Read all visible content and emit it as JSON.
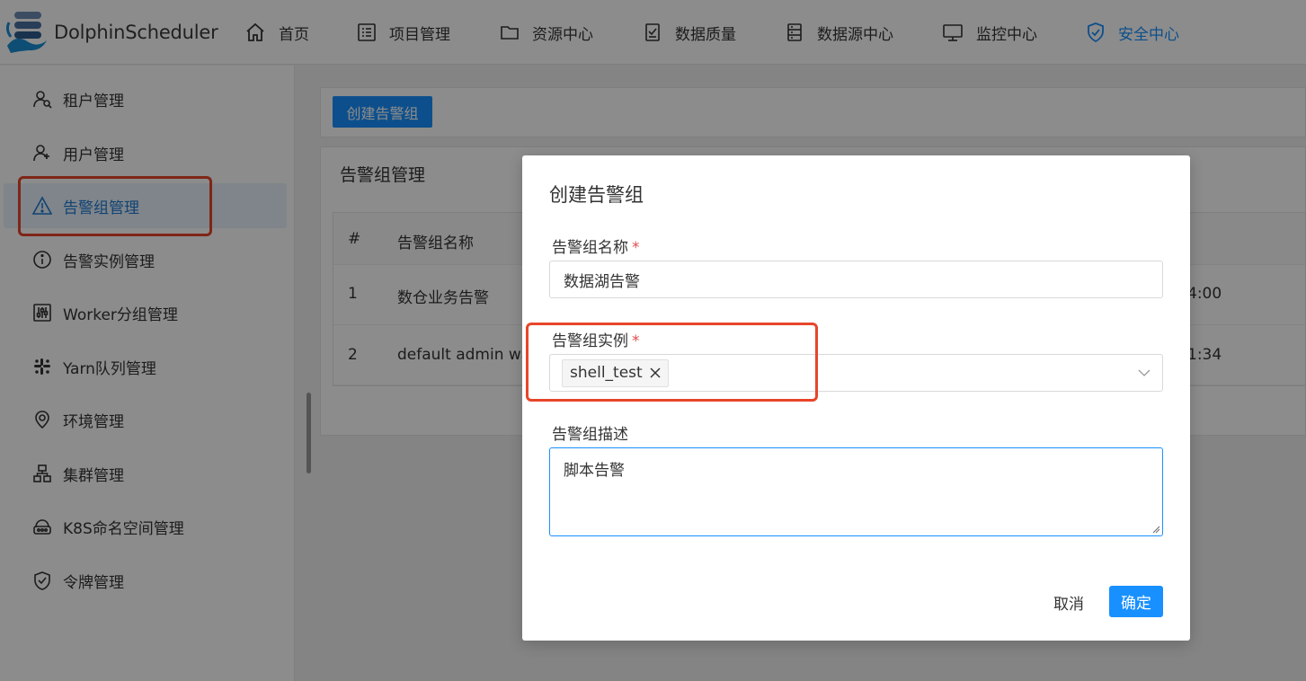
{
  "app": {
    "name": "DolphinScheduler"
  },
  "nav": {
    "items": [
      {
        "label": "首页",
        "icon": "home-icon"
      },
      {
        "label": "项目管理",
        "icon": "project-icon"
      },
      {
        "label": "资源中心",
        "icon": "folder-icon"
      },
      {
        "label": "数据质量",
        "icon": "document-icon"
      },
      {
        "label": "数据源中心",
        "icon": "datasource-icon"
      },
      {
        "label": "监控中心",
        "icon": "monitor-icon"
      },
      {
        "label": "安全中心",
        "icon": "shield-icon",
        "active": true
      }
    ]
  },
  "sidebar": {
    "items": [
      {
        "label": "租户管理",
        "icon": "tenant-icon"
      },
      {
        "label": "用户管理",
        "icon": "user-icon"
      },
      {
        "label": "告警组管理",
        "icon": "warning-icon",
        "active": true
      },
      {
        "label": "告警实例管理",
        "icon": "info-icon"
      },
      {
        "label": "Worker分组管理",
        "icon": "worker-icon"
      },
      {
        "label": "Yarn队列管理",
        "icon": "yarn-icon"
      },
      {
        "label": "环境管理",
        "icon": "location-icon"
      },
      {
        "label": "集群管理",
        "icon": "cluster-icon"
      },
      {
        "label": "K8S命名空间管理",
        "icon": "k8s-icon"
      },
      {
        "label": "令牌管理",
        "icon": "token-icon"
      }
    ]
  },
  "main": {
    "create_button": "创建告警组",
    "card_title": "告警组管理",
    "table": {
      "headers": [
        "#",
        "告警组名称"
      ],
      "rows": [
        {
          "index": "1",
          "name": "数仓业务告警",
          "time": "4:00"
        },
        {
          "index": "2",
          "name": "default admin wa",
          "time": "1:34"
        }
      ]
    }
  },
  "modal": {
    "title": "创建告警组",
    "name_label": "告警组名称",
    "name_value": "数据湖告警",
    "instance_label": "告警组实例",
    "instance_tag": "shell_test",
    "desc_label": "告警组描述",
    "desc_value": "脚本告警",
    "required_mark": "*",
    "cancel_label": "取消",
    "confirm_label": "确定"
  },
  "colors": {
    "primary": "#1890ff",
    "highlight": "#e8452a",
    "required": "#e34c4c"
  }
}
